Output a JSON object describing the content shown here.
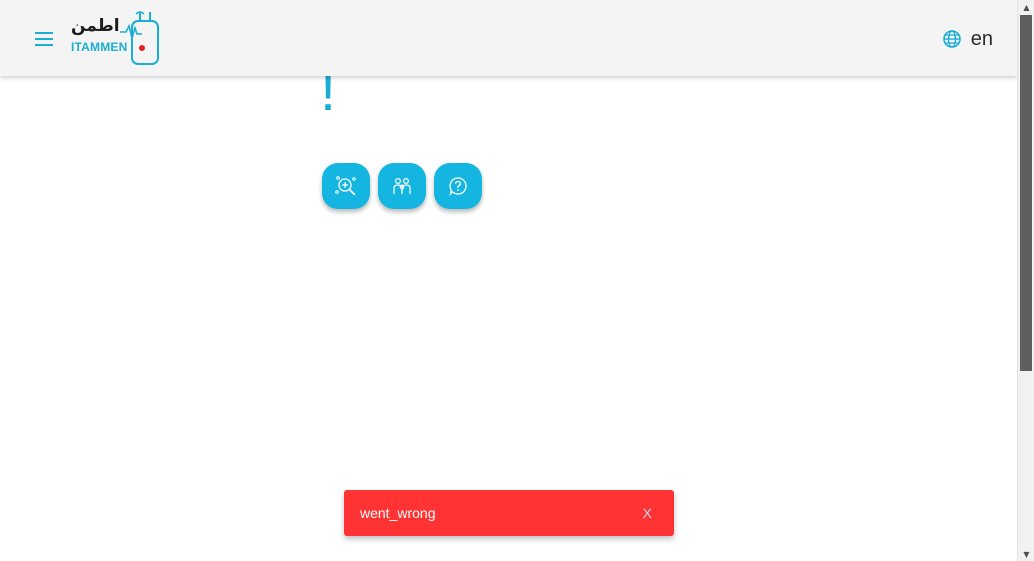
{
  "header": {
    "logo": {
      "arabic_text": "اطمن",
      "english_text": "ITAMMEN"
    },
    "language_label": "en",
    "icons": {
      "menu": "menu-icon",
      "language": "globe-icon"
    }
  },
  "main": {
    "heading_fragment": "!",
    "action_buttons": [
      {
        "icon": "medical-search-icon"
      },
      {
        "icon": "family-group-icon"
      },
      {
        "icon": "help-question-icon"
      }
    ]
  },
  "toast": {
    "message": "went_wrong",
    "close_label": "X"
  },
  "colors": {
    "accent": "#1aaed6",
    "button": "#14b5e0",
    "header_bg": "#f4f4f4",
    "toast_bg": "#ff3333",
    "logo_dot": "#e41e26"
  }
}
